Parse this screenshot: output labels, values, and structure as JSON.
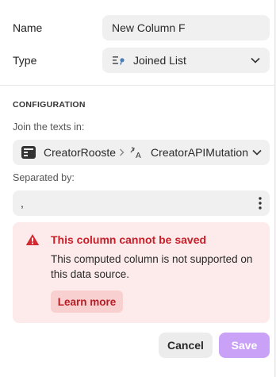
{
  "form": {
    "name_label": "Name",
    "name_value": "New Column F",
    "type_label": "Type",
    "type_value": "Joined List",
    "type_icon": "joined-list-icon"
  },
  "configuration": {
    "section_title": "CONFIGURATION",
    "join_label": "Join the texts in:",
    "join_source": "CreatorRooste",
    "join_separator_glyph": "›",
    "join_target": "CreatorAPIMutation",
    "separated_label": "Separated by:",
    "separator_value": ","
  },
  "error": {
    "title": "This column cannot be saved",
    "body": "This computed column is not supported on this data source.",
    "learn_more": "Learn more",
    "color": "#c8202a"
  },
  "footer": {
    "cancel_label": "Cancel",
    "save_label": "Save",
    "save_color": "#c9a2f7"
  }
}
